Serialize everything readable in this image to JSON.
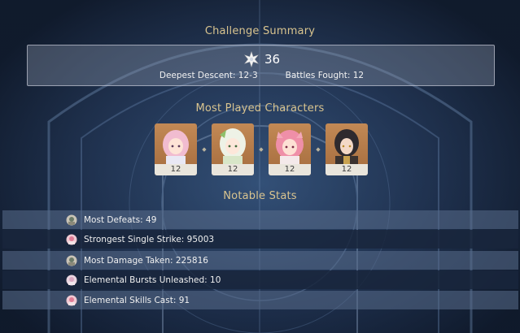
{
  "summary": {
    "title": "Challenge Summary",
    "star_icon": "abyss-star-icon",
    "stars": "36",
    "deepest_descent": "Deepest Descent: 12-3",
    "battles_fought": "Battles Fought: 12"
  },
  "characters": {
    "title": "Most Played Characters",
    "list": [
      {
        "name_icon": "character-portrait-pink-hair",
        "level": "12"
      },
      {
        "name_icon": "character-portrait-white-hair",
        "level": "12"
      },
      {
        "name_icon": "character-portrait-pink-fox-ears",
        "level": "12"
      },
      {
        "name_icon": "character-portrait-dark-hair",
        "level": "12"
      }
    ]
  },
  "notable": {
    "title": "Notable Stats",
    "rows": [
      {
        "icon": "character-avatar-icon",
        "text": "Most Defeats: 49"
      },
      {
        "icon": "character-avatar-icon",
        "text": "Strongest Single Strike: 95003"
      },
      {
        "icon": "character-avatar-icon",
        "text": "Most Damage Taken: 225816"
      },
      {
        "icon": "character-avatar-icon",
        "text": "Elemental Bursts Unleashed: 10"
      },
      {
        "icon": "character-avatar-icon",
        "text": "Elemental Skills Cast: 91"
      }
    ]
  },
  "colors": {
    "title_gold": "#d9c48f",
    "row_light": "#5a6e8c",
    "row_dark": "#19263c"
  }
}
